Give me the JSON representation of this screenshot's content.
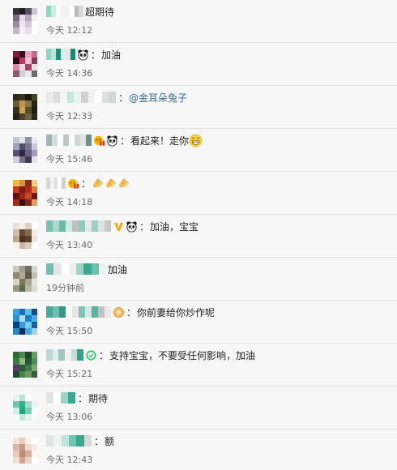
{
  "comments": [
    {
      "segments": [
        {
          "kind": "uname",
          "cells": [
            "#8fd7c0",
            "#c7eee2",
            "#ffffff",
            "#f2f2f2",
            "#f2f2f2",
            "#ffffff",
            "#bdbdbd",
            "#d9d9d9"
          ],
          "w": 46
        }
      ],
      "separator": "",
      "text": "超期待",
      "mention": "",
      "time": "今天 12:12",
      "avatar": [
        "#3a2f3c",
        "#1f1b22",
        "#5b4f66",
        "#cfc4d6",
        "#7a6a7e",
        "#e5d9ea",
        "#b9aabb",
        "#f2eff4",
        "#9c8aa0",
        "#f0e6f2",
        "#d4c5d8",
        "#ffffff",
        "#c9b7cc",
        "#f5eef7",
        "#e8dfe9",
        "#ffffff"
      ]
    },
    {
      "segments": [
        {
          "kind": "uname",
          "cells": [
            "#8fd7c0",
            "#b7e6d8",
            "#1d8e77",
            "#d8f1ea",
            "#e5e5e5",
            "#138a73"
          ],
          "w": 36
        },
        {
          "kind": "icon",
          "icon": "panda-icon"
        }
      ],
      "separator": "：",
      "text": "加油",
      "mention": "",
      "time": "今天 14:36",
      "avatar": [
        "#7b1f3b",
        "#3d1020",
        "#e6a1b8",
        "#c76a90",
        "#2a0c17",
        "#b83a66",
        "#f2c3d3",
        "#8a3757",
        "#d98aa6",
        "#f5d7e2",
        "#a24567",
        "#e0e0e0",
        "#8c5a6e",
        "#cfcfcf",
        "#e9e9e9",
        "#6b6b6b"
      ]
    },
    {
      "segments": [
        {
          "kind": "uname",
          "cells": [
            "#e9e9e9",
            "#dcdcdc",
            "#f4f4f4",
            "#c8e6de",
            "#e6f4f0",
            "#d0d0d0",
            "#f0f0f0",
            "#ffffff",
            "#e0e0e0",
            "#cfd8d6"
          ],
          "w": 86
        }
      ],
      "separator": "：",
      "text": "",
      "mention": "@金耳朵兔子",
      "time": "今天 12:33",
      "avatar": [
        "#2b2a1c",
        "#3b3520",
        "#1c1a12",
        "#4a4328",
        "#6a5d36",
        "#b89a55",
        "#8c7443",
        "#2a2618",
        "#3a3322",
        "#caa65c",
        "#5a4a2c",
        "#1e1c14",
        "#25231a",
        "#4b4230",
        "#6e6040",
        "#2e2b20"
      ]
    },
    {
      "segments": [
        {
          "kind": "uname",
          "cells": [
            "#9fb6b2",
            "#d7dedc",
            "#ffffff",
            "#bcc8c6",
            "#ffffff",
            "#cfd6d4",
            "#e3e3e3",
            "#6f8f8a"
          ],
          "w": 56
        },
        {
          "kind": "icon",
          "icon": "gift-icon"
        },
        {
          "kind": "icon",
          "icon": "panda-icon"
        }
      ],
      "separator": "：",
      "text": "看起来！走你",
      "mention": "",
      "time": "今天 15:46",
      "avatar": [
        "#bfc6d6",
        "#dfe3ec",
        "#8f95a8",
        "#e9ecf3",
        "#9aa3b8",
        "#4d4e6a",
        "#7a6f8e",
        "#c6c9d6",
        "#5a5373",
        "#2e2941",
        "#6b5e83",
        "#a79cb5",
        "#d2ccdb",
        "#7b7290",
        "#3f3a55",
        "#e4e0ea"
      ]
    },
    {
      "segments": [
        {
          "kind": "uname",
          "cells": [
            "#d6d6d6",
            "#f2f2f2",
            "#e0e0e0",
            "#ffffff",
            "#cfcfcf"
          ],
          "w": 24
        },
        {
          "kind": "icon",
          "icon": "gift-icon"
        }
      ],
      "separator": "：",
      "text": "",
      "mention": "",
      "time": "今天 14:18",
      "trailing_icons": [
        "clap-icon",
        "clap-icon",
        "clap-icon"
      ],
      "avatar": [
        "#e6b94a",
        "#d9933a",
        "#8a2a1a",
        "#f0d27a",
        "#c43a23",
        "#7a1a12",
        "#b02a1c",
        "#e07a3a",
        "#5a1410",
        "#9e2216",
        "#c7482a",
        "#6b1a12",
        "#a3281b",
        "#3f0e0a",
        "#8c241a",
        "#e3a055"
      ]
    },
    {
      "segments": [
        {
          "kind": "uname",
          "cells": [
            "#7fbfb0",
            "#a9d8cc",
            "#6fb7a8",
            "#cfe9e2",
            "#bfbfbf",
            "#8ec9bc",
            "#e6e6e6",
            "#9ccfc4",
            "#e0e0e0",
            "#c8c8c8"
          ],
          "w": 80
        },
        {
          "kind": "icon",
          "icon": "vip-v-icon"
        },
        {
          "kind": "icon",
          "icon": "panda-icon"
        }
      ],
      "separator": "：",
      "text": "加油，宝宝",
      "mention": "",
      "time": "今天 13:40",
      "avatar": [
        "#e6e2dc",
        "#f3f1ee",
        "#d9d2c8",
        "#ffffff",
        "#cbbfb0",
        "#6b4a33",
        "#8a6a4f",
        "#f0ece6",
        "#bca78f",
        "#4a3322",
        "#5e422e",
        "#ebe5de",
        "#f5f3f0",
        "#c9b8a3",
        "#d8cbbb",
        "#ffffff"
      ]
    },
    {
      "segments": [
        {
          "kind": "uname",
          "cells": [
            "#6fbfb0",
            "#e5e5e5",
            "#ffffff",
            "#f0f0f0",
            "#9fd2c6",
            "#3aa88f",
            "#6cc0ad",
            "#e9f5f2"
          ],
          "w": 74
        }
      ],
      "separator": "",
      "text": "加油",
      "mention": "",
      "time": "19分钟前",
      "avatar": [
        "#c9c9c0",
        "#9c9a8a",
        "#6f6d5f",
        "#d8d7cf",
        "#8e8a74",
        "#b0ad97",
        "#5e5a48",
        "#c3c0ad",
        "#d6d3c4",
        "#7c7860",
        "#a7a38c",
        "#e5e3da",
        "#9a9680",
        "#5a6a52",
        "#b8b49e",
        "#dcdad0"
      ]
    },
    {
      "segments": [
        {
          "kind": "uname",
          "cells": [
            "#4aa89a",
            "#6fbcae",
            "#3a9889",
            "#ffffff",
            "#e5e5e5",
            "#7fc4b6",
            "#d0e9e3",
            "#5fb2a3",
            "#c0c0c0",
            "#e9e9e9"
          ],
          "w": 80
        },
        {
          "kind": "icon",
          "icon": "medal-icon"
        }
      ],
      "separator": "：",
      "text": "你前妻给你炒作呢",
      "mention": "",
      "time": "今天 15:50",
      "avatar": [
        "#3aa1d8",
        "#1a6fb8",
        "#5fc1e8",
        "#0f4f8f",
        "#2b8fd1",
        "#a8def5",
        "#1c7cc4",
        "#4ab0e0",
        "#0d3f7a",
        "#3d9ad8",
        "#76cdee",
        "#1a5ea6",
        "#2684c9",
        "#0a335f",
        "#4aa8dc",
        "#9ad6f2"
      ]
    },
    {
      "segments": [
        {
          "kind": "uname",
          "cells": [
            "#bcd7d2",
            "#e0eeeb",
            "#9fc7bf",
            "#f2f2f2",
            "#c4ddd8",
            "#3a9e8a"
          ],
          "w": 46
        },
        {
          "kind": "icon",
          "icon": "fan-badge-icon"
        }
      ],
      "separator": "：",
      "text": "支持宝宝，不要受任何影响，加油",
      "mention": "",
      "time": "今天 15:21",
      "avatar": [
        "#2f6a3a",
        "#4a8a4f",
        "#1f4a2a",
        "#6aa05f",
        "#3a7a44",
        "#8fb87a",
        "#25553a",
        "#4d8f5a",
        "#5a3a6e",
        "#2a5a3a",
        "#3f7a4a",
        "#7aa86a",
        "#1e4a2e",
        "#4e7e52",
        "#6a9a5e",
        "#355e3e"
      ]
    },
    {
      "segments": [
        {
          "kind": "uname",
          "cells": [
            "#e3e3e3",
            "#ffffff",
            "#9fd2c6",
            "#3aa88f"
          ],
          "w": 36
        }
      ],
      "separator": "：",
      "text": "期待",
      "mention": "",
      "time": "今天 13:06",
      "avatar": [
        "#e8f2f0",
        "#bfe3da",
        "#ffffff",
        "#f3f8f7",
        "#6fc6b0",
        "#2fb08f",
        "#a6dccd",
        "#e9f4f1",
        "#d4ece6",
        "#1fa383",
        "#7ccbb6",
        "#ffffff",
        "#f1f7f5",
        "#c4e6dd",
        "#e2f1ed",
        "#f7fbfa"
      ]
    },
    {
      "segments": [
        {
          "kind": "uname",
          "cells": [
            "#e3e3e3",
            "#f2f2f2",
            "#bfe3da",
            "#6fc6b0",
            "#3aa88f",
            "#d9d9d9"
          ],
          "w": 56
        }
      ],
      "separator": "：",
      "text": "额",
      "mention": "",
      "time": "今天 12:43",
      "avatar": [
        "#f3e3da",
        "#e8cdbf",
        "#fbf1ea",
        "#ffffff",
        "#d9b7a5",
        "#c79a84",
        "#efd9cc",
        "#f7ece5",
        "#e6c9b9",
        "#b88a73",
        "#d5ae99",
        "#fdf5f0",
        "#f1e0d6",
        "#cfa792",
        "#e9d2c4",
        "#ffffff"
      ]
    }
  ]
}
